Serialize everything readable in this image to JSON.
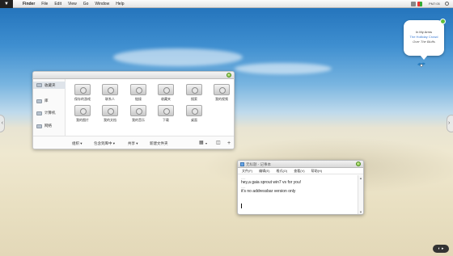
{
  "menubar": {
    "apple_label": "",
    "items": [
      "Finder",
      "File",
      "Edit",
      "View",
      "Go",
      "Window",
      "Help"
    ],
    "clock": "PM7:05",
    "tray_icons": [
      "volume-icon",
      "flag-icon",
      "battery-icon",
      "search-icon"
    ]
  },
  "bubble": {
    "line1": "In My Arms",
    "line2": "The Holliday Crowd",
    "line3": "Over The Bluffs"
  },
  "explorer": {
    "sidebar": [
      "收藏夹",
      "库",
      "计算机",
      "网络"
    ],
    "tiles": [
      "保存的游戏",
      "联系人",
      "链接",
      "收藏夹",
      "搜索",
      "我的视频",
      "我的图片",
      "我的文档",
      "我的音乐",
      "下载",
      "桌面"
    ],
    "toolbar": {
      "organize": "组织 ▾",
      "include": "包含到库中 ▾",
      "share": "共享 ▾",
      "new_folder": "新建文件夹"
    }
  },
  "notepad": {
    "title": "无标题 - 记事本",
    "menu": [
      "文件(F)",
      "编辑(E)",
      "格式(O)",
      "查看(V)",
      "帮助(H)"
    ],
    "lines": [
      "hey,a gaia sprout win7 vs for you!",
      "it's no addressbar version only"
    ],
    "separator": "----"
  },
  "arrows": {
    "left": "‹",
    "right": "›"
  },
  "corner": "◐ ▸"
}
